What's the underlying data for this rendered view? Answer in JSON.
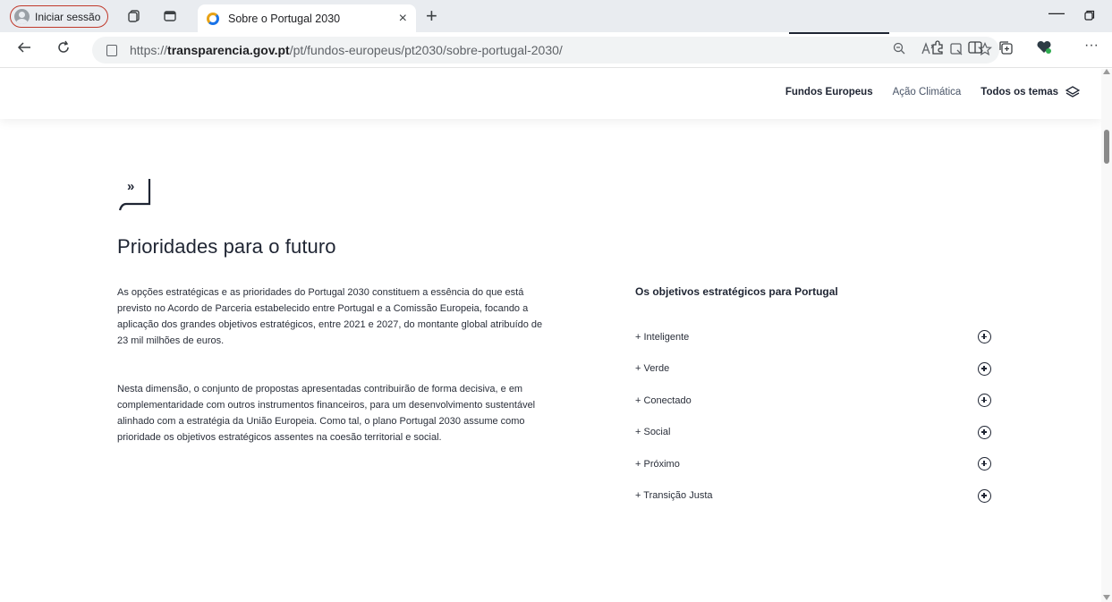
{
  "browser": {
    "profile_label": "Iniciar sessão",
    "tab_title": "Sobre o Portugal 2030",
    "tab_close": "×",
    "new_tab": "+",
    "minimize": "—",
    "url_prefix": "https://",
    "url_host": "transparencia.gov.pt",
    "url_path": "/pt/fundos-europeus/pt2030/sobre-portugal-2030/"
  },
  "site_nav": {
    "items": [
      {
        "label": "Fundos Europeus"
      },
      {
        "label": "Ação Climática"
      },
      {
        "label": "Todos os temas"
      }
    ]
  },
  "main": {
    "quote_mark": "»",
    "title": "Prioridades para o futuro",
    "paragraphs": [
      "As opções estratégicas e as prioridades do Portugal 2030 constituem a essência do que está previsto no Acordo de Parceria estabelecido entre Portugal e a Comissão Europeia, focando a aplicação dos grandes objetivos estratégicos, entre 2021 e 2027, do montante global atribuído de 23 mil milhões de euros.",
      "Nesta dimensão, o conjunto de propostas apresentadas contribuirão de forma decisiva, e em complementaridade com outros instrumentos financeiros, para um desenvolvimento sustentável alinhado com a estratégia da União Europeia. Como tal, o plano Portugal 2030 assume como prioridade os objetivos estratégicos assentes na coesão territorial e social."
    ]
  },
  "objectives": {
    "title": "Os objetivos estratégicos para Portugal",
    "items": [
      {
        "label": "+ Inteligente"
      },
      {
        "label": "+ Verde"
      },
      {
        "label": "+ Conectado"
      },
      {
        "label": "+ Social"
      },
      {
        "label": "+ Próximo"
      },
      {
        "label": "+ Transição Justa"
      }
    ]
  },
  "colors": {
    "text_dark": "#1f2533",
    "profile_border": "#c0392b",
    "tabbar_bg": "#e9ecf0"
  }
}
